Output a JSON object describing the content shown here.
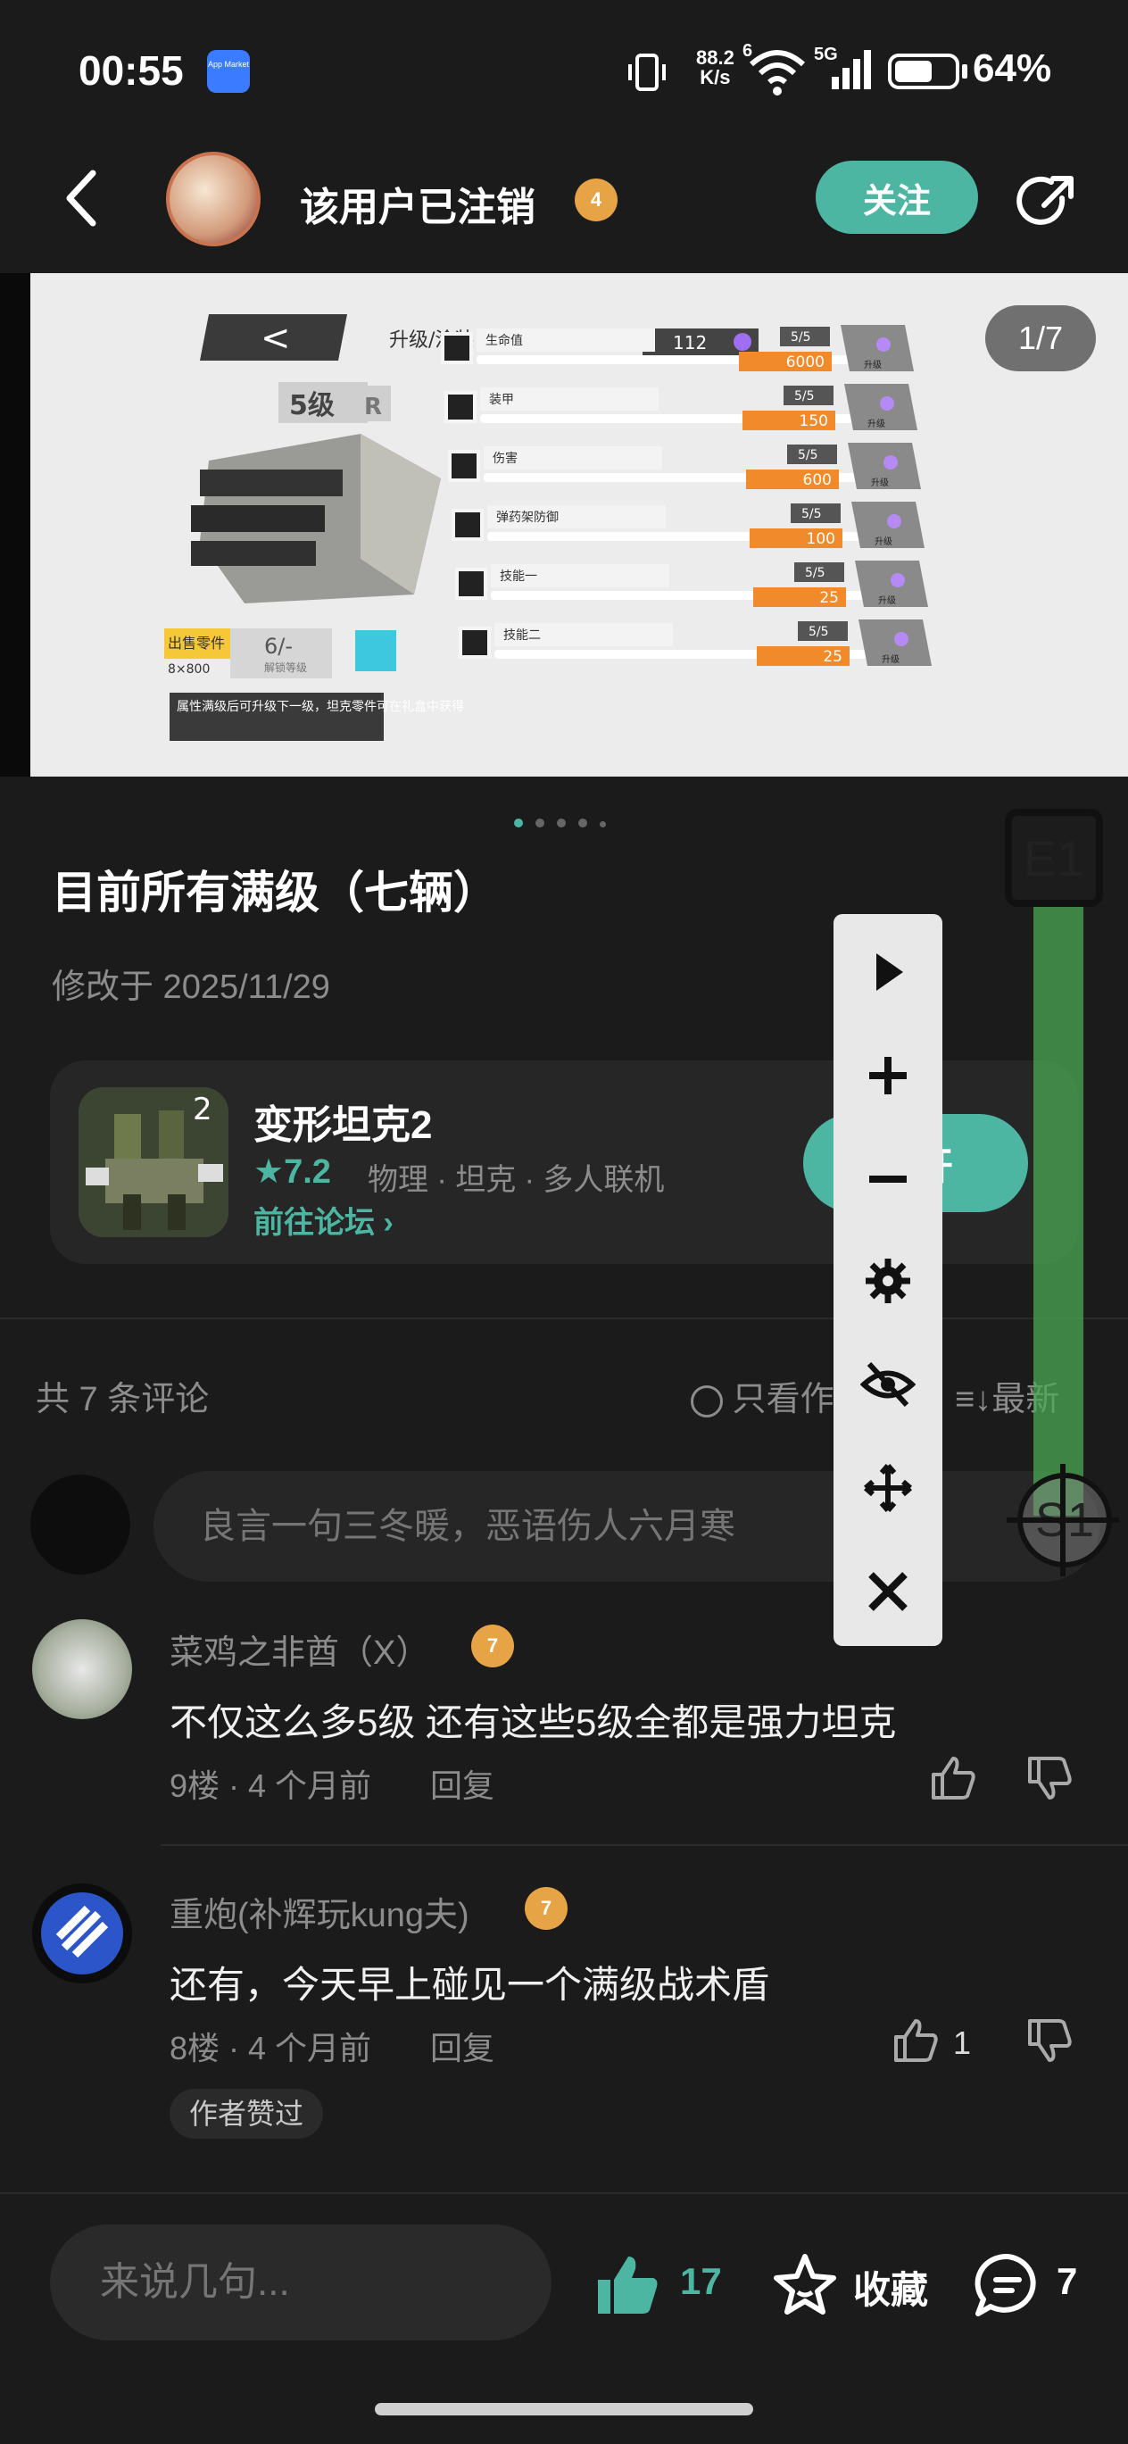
{
  "status_bar": {
    "time": "00:55",
    "app_market": "App Market",
    "net_speed_value": "88.2",
    "net_speed_unit": "K/s",
    "wifi_label": "6",
    "cell_label": "5G",
    "battery_percent": "64%",
    "battery_level": 0.64
  },
  "header": {
    "username": "该用户已注销",
    "level": "4",
    "follow_label": "关注"
  },
  "gallery": {
    "counter": "1/7",
    "screenshot": {
      "back": "<",
      "tab": "升级/涂装",
      "currency": "112",
      "level": "5级",
      "rarity": "R",
      "sell_label": "出售零件",
      "sell_price": "8×800",
      "parts_count": "6/-",
      "parts_label": "解锁等级",
      "note": "属性满级后可升级下一级，坦克零件可在礼盒中获得",
      "upgrade": "升级",
      "stats": [
        {
          "name": "生命值",
          "progress": "5/5",
          "value": "6000"
        },
        {
          "name": "装甲",
          "progress": "5/5",
          "value": "150"
        },
        {
          "name": "伤害",
          "progress": "5/5",
          "value": "600"
        },
        {
          "name": "弹药架防御",
          "progress": "5/5",
          "value": "100"
        },
        {
          "name": "技能一",
          "progress": "5/5",
          "value": "25"
        },
        {
          "name": "技能二",
          "progress": "5/5",
          "value": "25"
        }
      ]
    }
  },
  "post": {
    "title": "目前所有满级（七辆）",
    "modified": "修改于 2025/11/29"
  },
  "game_card": {
    "name": "变形坦克2",
    "rating": "7.2",
    "tags": "物理 · 坦克 · 多人联机",
    "forum_link": "前往论坛",
    "open_label": "打开"
  },
  "comments_header": {
    "count": "共 7 条评论",
    "only_author": "只看作者",
    "sort": "最新"
  },
  "comment_input": {
    "placeholder": "良言一句三冬暖，恶语伤人六月寒"
  },
  "comments": [
    {
      "name": "菜鸡之非酋（X）",
      "level": "7",
      "text": "不仅这么多5级 还有这些5级全都是强力坦克",
      "floor": "9楼 · 4 个月前",
      "reply": "回复",
      "likes": ""
    },
    {
      "name": "重炮(补辉玩kung夫)",
      "level": "7",
      "text": "还有，今天早上碰见一个满级战术盾",
      "floor": "8楼 · 4 个月前",
      "reply": "回复",
      "likes": "1",
      "badge": "作者赞过"
    }
  ],
  "overlay": {
    "e1": "E1",
    "s1": "S1"
  },
  "bottom_bar": {
    "input_placeholder": "来说几句...",
    "likes": "17",
    "favorite_label": "收藏",
    "comments": "7"
  },
  "colors": {
    "accent": "#4db6a3",
    "background": "#1b1b1b",
    "card": "#262626",
    "level_badge": "#e7a447"
  }
}
